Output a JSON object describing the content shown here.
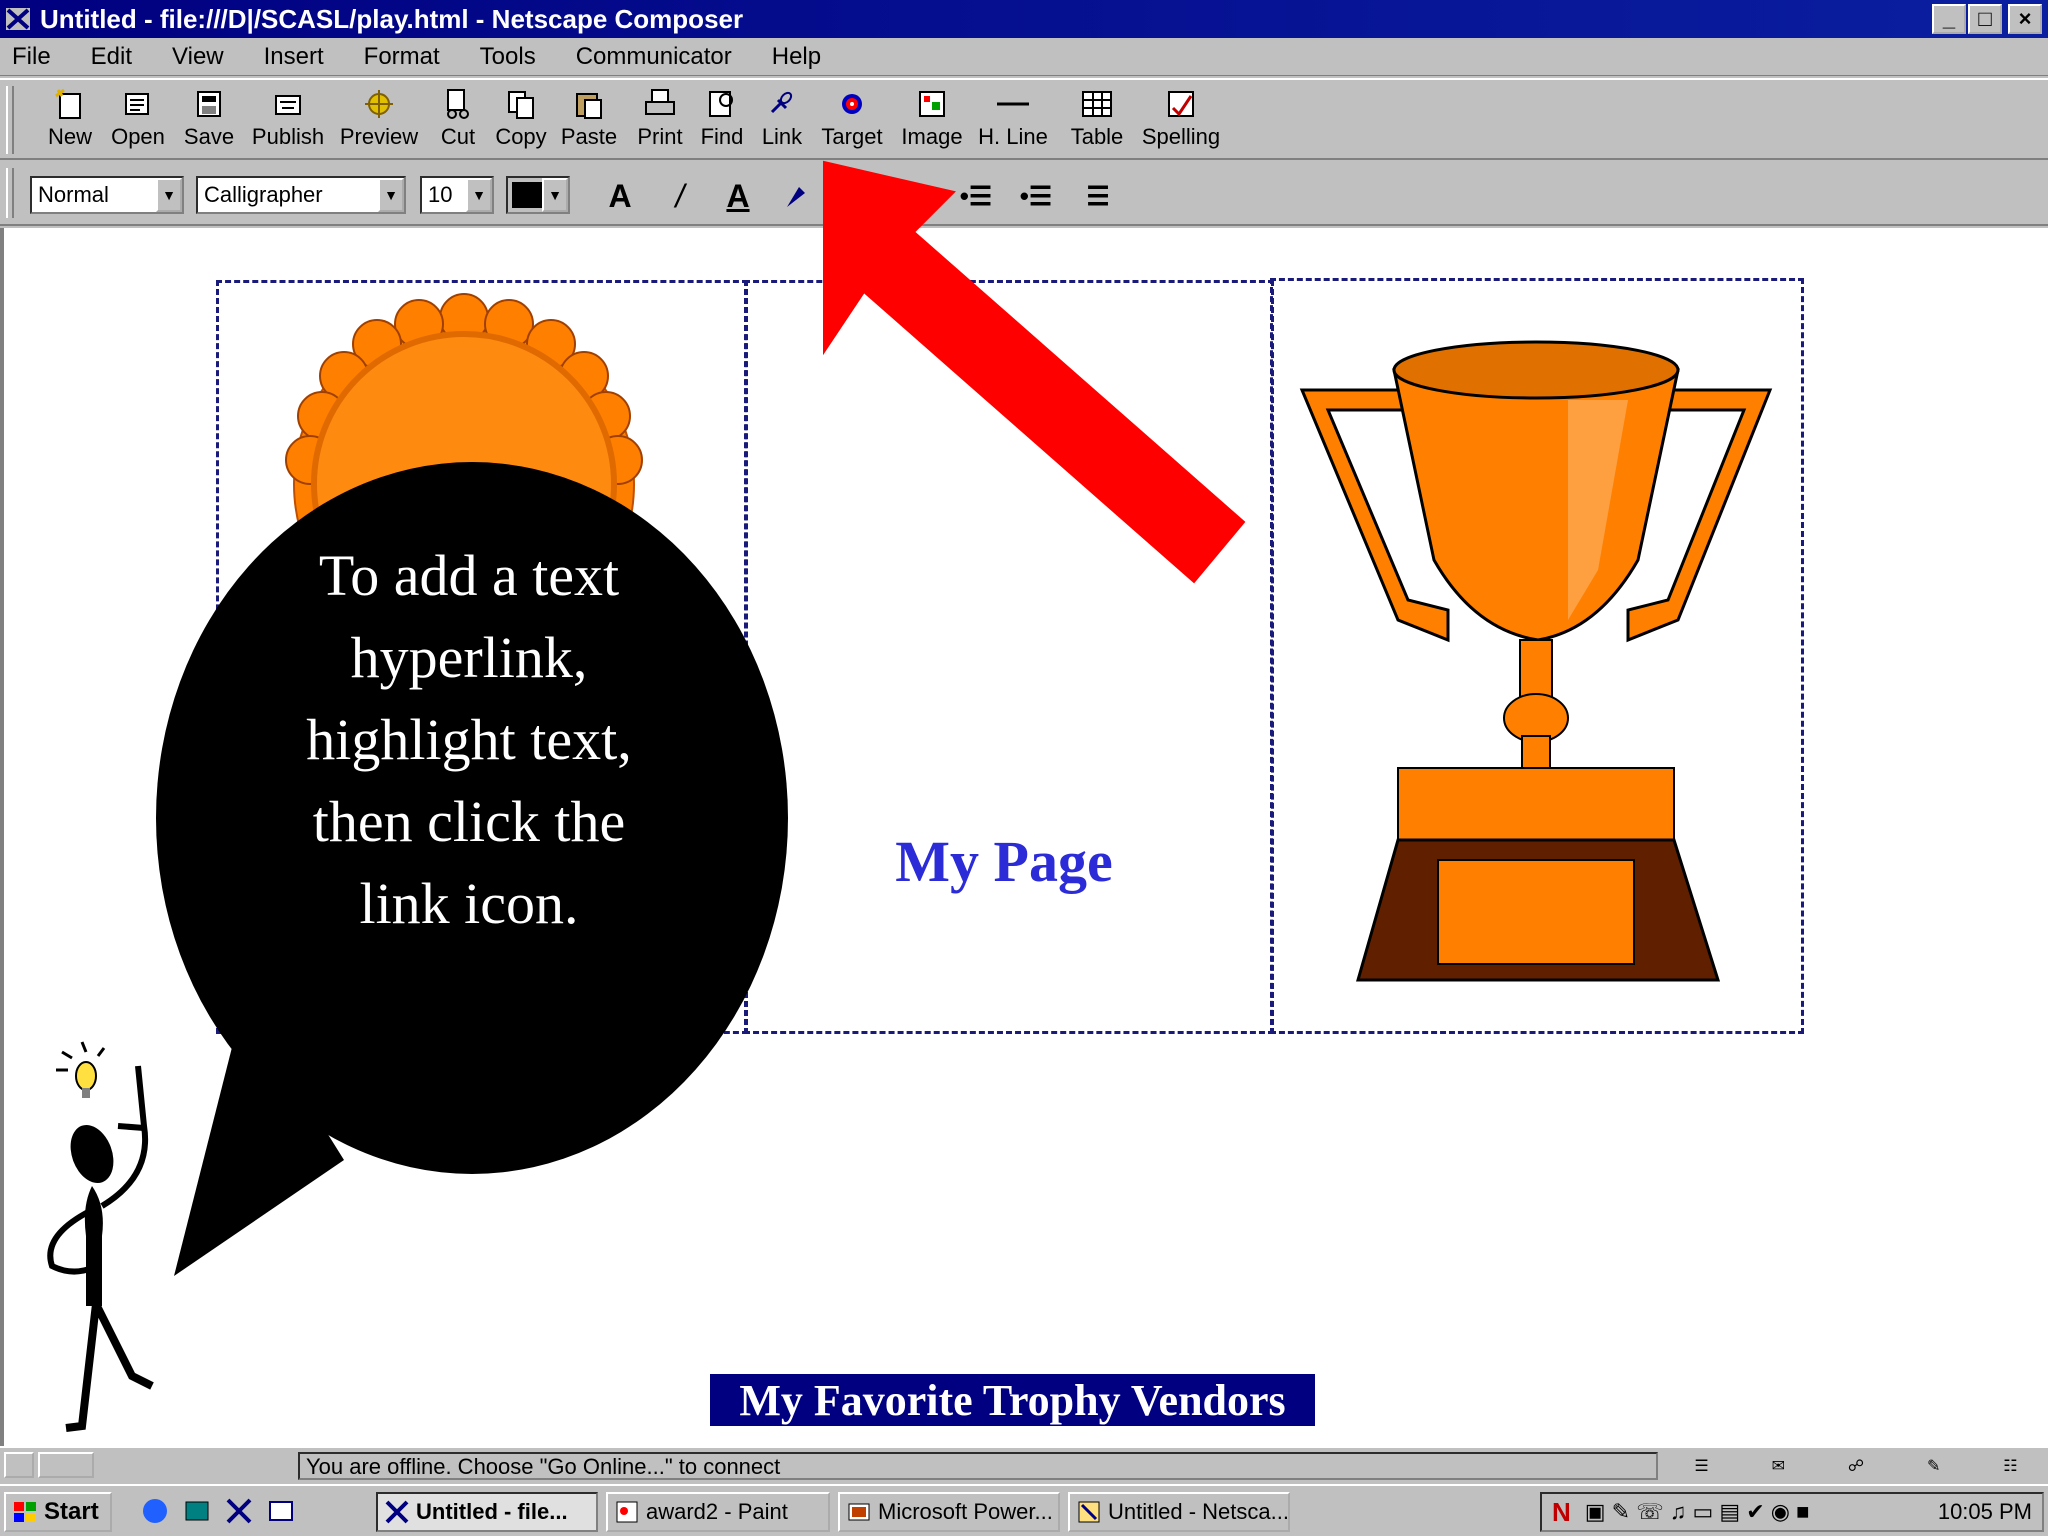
{
  "window": {
    "title": "Untitled - file:///D|/SCASL/play.html - Netscape Composer",
    "minimize": "_",
    "maximize": "□",
    "close": "×"
  },
  "menu": [
    "File",
    "Edit",
    "View",
    "Insert",
    "Format",
    "Tools",
    "Communicator",
    "Help"
  ],
  "toolbar": {
    "buttons": [
      {
        "label": "New",
        "icon": "new-page-icon"
      },
      {
        "label": "Open",
        "icon": "open-icon"
      },
      {
        "label": "Save",
        "icon": "save-icon"
      },
      {
        "label": "Publish",
        "icon": "publish-icon"
      },
      {
        "label": "Preview",
        "icon": "preview-icon"
      },
      {
        "label": "Cut",
        "icon": "cut-icon"
      },
      {
        "label": "Copy",
        "icon": "copy-icon"
      },
      {
        "label": "Paste",
        "icon": "paste-icon"
      },
      {
        "label": "Print",
        "icon": "print-icon"
      },
      {
        "label": "Find",
        "icon": "find-icon"
      },
      {
        "label": "Link",
        "icon": "link-icon"
      },
      {
        "label": "Target",
        "icon": "target-icon"
      },
      {
        "label": "Image",
        "icon": "image-icon"
      },
      {
        "label": "H. Line",
        "icon": "hline-icon"
      },
      {
        "label": "Table",
        "icon": "table-icon"
      },
      {
        "label": "Spelling",
        "icon": "spelling-icon"
      }
    ]
  },
  "format_bar": {
    "paragraph_style": "Normal",
    "font": "Calligrapher",
    "size": "10",
    "color": "#000000"
  },
  "document": {
    "heading": "My Page",
    "selected_text": "My Favorite Trophy Vendors"
  },
  "callout": {
    "lines": [
      "To add a text",
      "hyperlink,",
      "highlight text,",
      "then click the",
      "link icon."
    ]
  },
  "statusbar": {
    "message": "You are offline. Choose \"Go Online...\" to connect"
  },
  "taskbar": {
    "start": "Start",
    "tasks": [
      {
        "label": "Untitled - file...",
        "active": true
      },
      {
        "label": "award2 - Paint",
        "active": false
      },
      {
        "label": "Microsoft Power...",
        "active": false
      },
      {
        "label": "Untitled - Netsca...",
        "active": false
      }
    ],
    "clock": "10:05 PM"
  },
  "colors": {
    "title_bar": "#000080",
    "heading": "#2b2bd8",
    "selection": "#000080",
    "arrow": "#ff0000",
    "trophy": "#ff8000"
  }
}
